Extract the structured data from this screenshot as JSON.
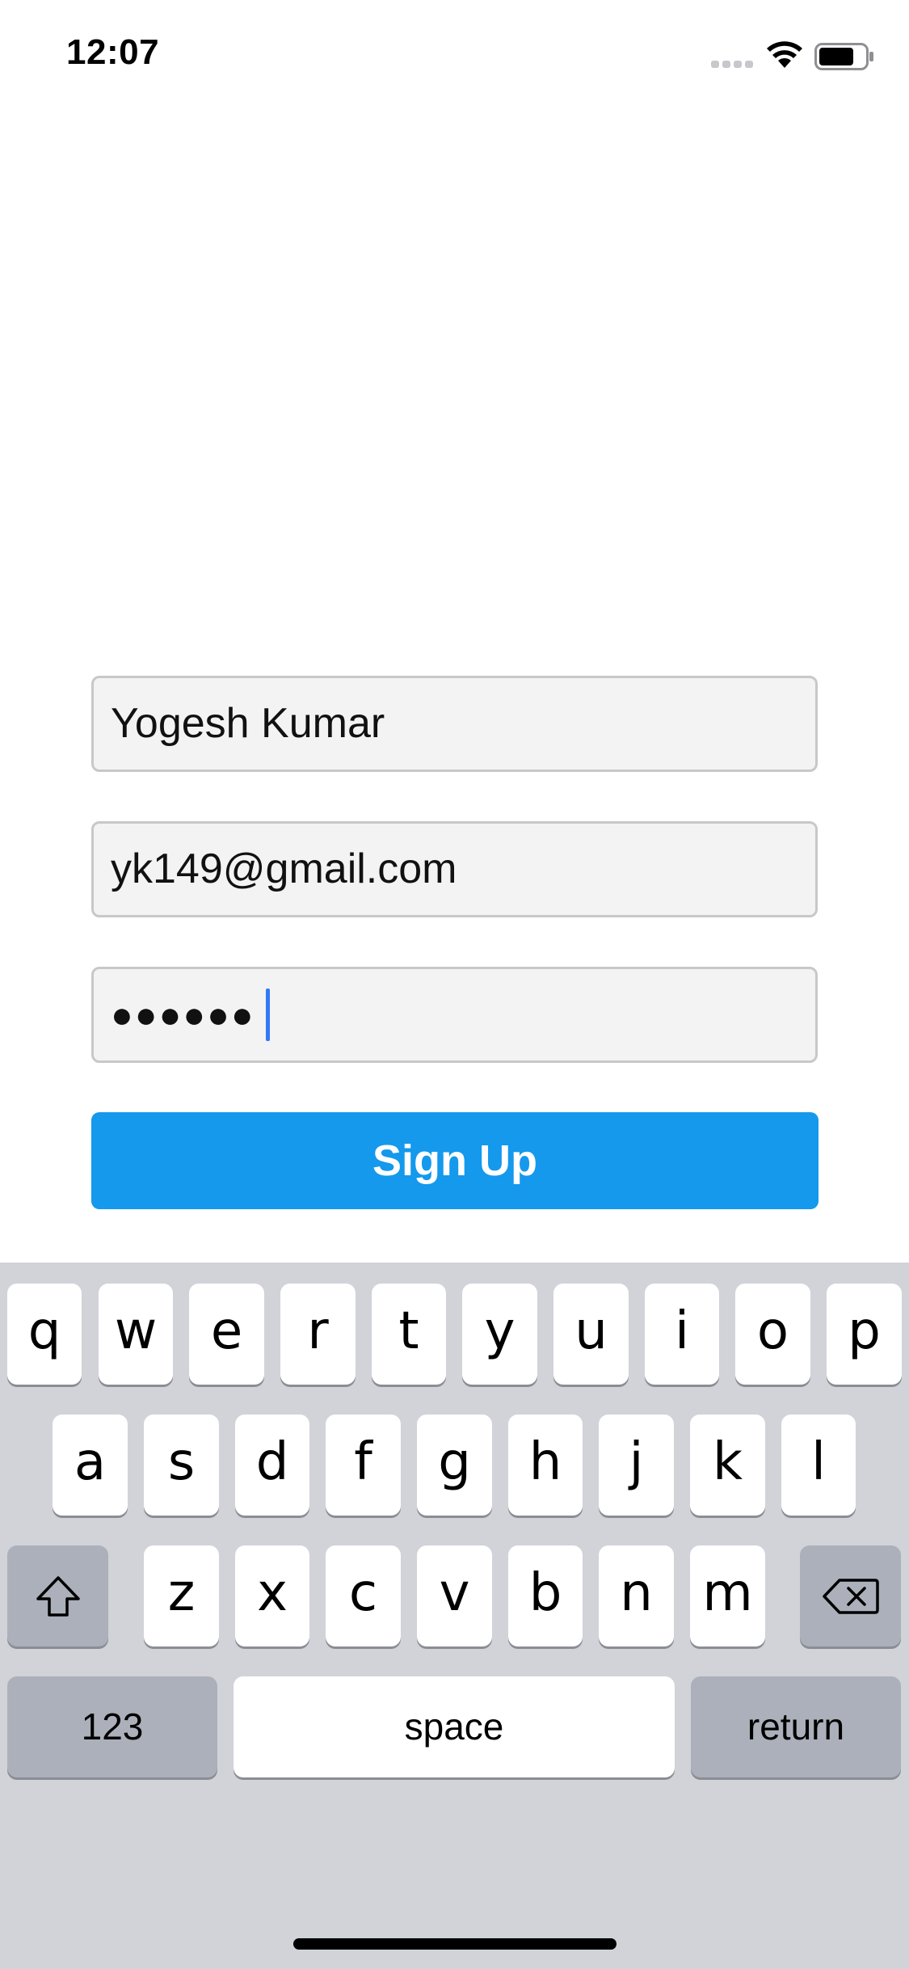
{
  "status_bar": {
    "time": "12:07",
    "signal_icon": "cellular-signal-icon",
    "wifi_icon": "wifi-icon",
    "battery_icon": "battery-icon"
  },
  "form": {
    "name_value": "Yogesh Kumar",
    "email_value": "yk149@gmail.com",
    "password_value": "●●●●●●",
    "signup_label": "Sign Up",
    "accent_color": "#1499ec"
  },
  "keyboard": {
    "row1": [
      "q",
      "w",
      "e",
      "r",
      "t",
      "y",
      "u",
      "i",
      "o",
      "p"
    ],
    "row2": [
      "a",
      "s",
      "d",
      "f",
      "g",
      "h",
      "j",
      "k",
      "l"
    ],
    "row3": [
      "z",
      "x",
      "c",
      "v",
      "b",
      "n",
      "m"
    ],
    "shift_icon": "shift-icon",
    "backspace_icon": "backspace-icon",
    "numbers_label": "123",
    "space_label": "space",
    "return_label": "return"
  }
}
